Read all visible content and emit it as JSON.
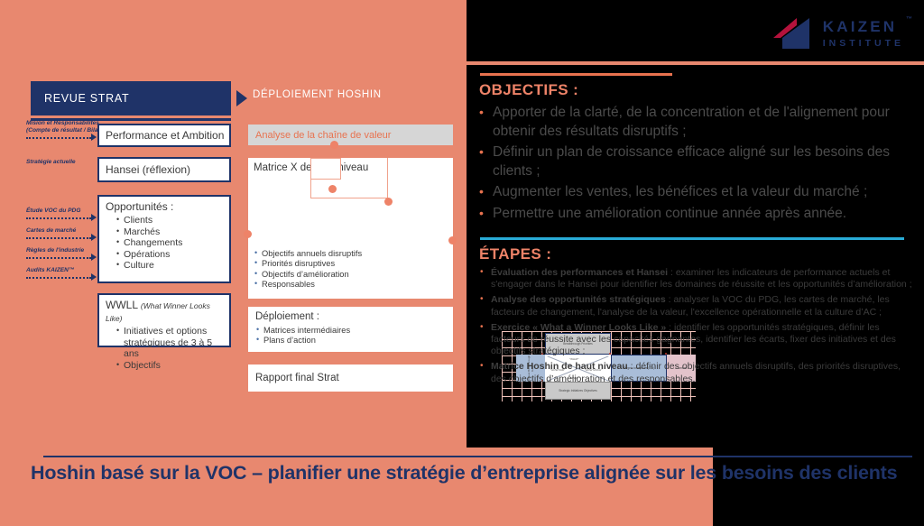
{
  "brand": {
    "logo_name": "kaizen-institute-logo",
    "kaizen": "KAIZEN",
    "tm": "™",
    "institute": "INSTITUTE",
    "navy": "#1F3368",
    "red": "#B4123C",
    "salmon": "#E8886F",
    "accent": "#E8724F",
    "cyan": "#29ABD6"
  },
  "left": {
    "header_bar": "REVUE STRAT",
    "deployment_title": "DÉPLOIEMENT HOSHIN",
    "side_labels": [
      "Mision et Responsabilites\n(Compte de résultat / Bilan)",
      "Stratégie actuelle",
      "Étude VOC du PDG",
      "Cartes de marché",
      "Règles de l'industrie",
      "Audits KAIZEN™"
    ],
    "side_label_1a": "Mision et Responsabilites",
    "side_label_1b": "(Compte de résultat / Bilan)",
    "side_label_2": "Stratégie actuelle",
    "side_label_3": "Étude VOC du PDG",
    "side_label_4": "Cartes de marché",
    "side_label_5": "Règles de l'industrie",
    "side_label_6": "Audits KAIZEN™",
    "box_performance": "Performance et Ambition",
    "box_hansei": "Hansei (réflexion)",
    "box_opportunites_title": "Opportunités :",
    "box_opportunites_items": [
      "Clients",
      "Marchés",
      "Changements",
      "Opérations",
      "Culture"
    ],
    "box_wwll_title": "WWLL",
    "box_wwll_subtitle": "(What Winner Looks Like)",
    "box_wwll_items": [
      "Initiatives et options stratégiques de 3 à 5 ans",
      "Objectifs"
    ]
  },
  "right_diagram": {
    "value_chain_bar": "Analyse de la chaîne de valeur",
    "matrix_title": "Matrice X de haut niveau",
    "matrix_cells": {
      "top": "Breakthrough\nPriorities",
      "left": "Annual\nBreakthrough\nGoals",
      "right": "Targets to Improve\n(TTI)",
      "far_right": "Owners",
      "bottom": "Strategic Initiatives\nObjectives",
      "x_top": "\"WHAT\"",
      "x_left": "\"HOW FAR\"",
      "x_right": "\"HOW MUCH\"",
      "x_bottom": "\"WHO\""
    },
    "matrix_bullets": [
      "Objectifs annuels disruptifs",
      "Priorités disruptives",
      "Objectifs d’amélioration",
      "Responsables"
    ],
    "deploy_title": "Déploiement :",
    "deploy_bullets": [
      "Matrices intermédiaires",
      "Plans d’action"
    ],
    "report_box": "Rapport final Strat"
  },
  "panel": {
    "objectifs_heading": "OBJECTIFS :",
    "objectifs": [
      "Apporter de la clarté, de la concentration et de l'alignement pour obtenir des résultats disruptifs ;",
      "Définir un plan de croissance efficace aligné sur les besoins des clients ;",
      "Augmenter les ventes, les bénéfices et la valeur du marché ;",
      "Permettre une amélioration continue année après année."
    ],
    "etapes_heading": "ÉTAPES :",
    "etapes": [
      {
        "bold": "Évaluation des performances et Hansei",
        "rest": " : examiner les indicateurs de performance actuels et s'engager dans le Hansei pour identifier les domaines de réussite et les opportunités d’amélioration ;"
      },
      {
        "bold": "Analyse des opportunités stratégiques",
        "rest": " : analyser la VOC du PDG, les cartes de marché, les facteurs de changement, l'analyse de la valeur, l'excellence opérationnelle et la culture d’AC ;"
      },
      {
        "bold": "Exercice « What a Winner Looks Like »",
        "rest": " : identifier les opportunités stratégiques, définir les facteurs de réussite avec les capacités gagnantes, identifier les écarts, fixer des initiatives et des objectifs stratégiques ;"
      },
      {
        "bold": "Matrice Hoshin de haut niveau",
        "rest": " : définir des objectifs annuels disruptifs, des priorités disruptives, des objectifs d’amélioration et des responsables."
      }
    ]
  },
  "footer": {
    "title": "Hoshin basé sur la VOC – planifier une stratégie d’entreprise alignée sur les besoins des clients"
  }
}
